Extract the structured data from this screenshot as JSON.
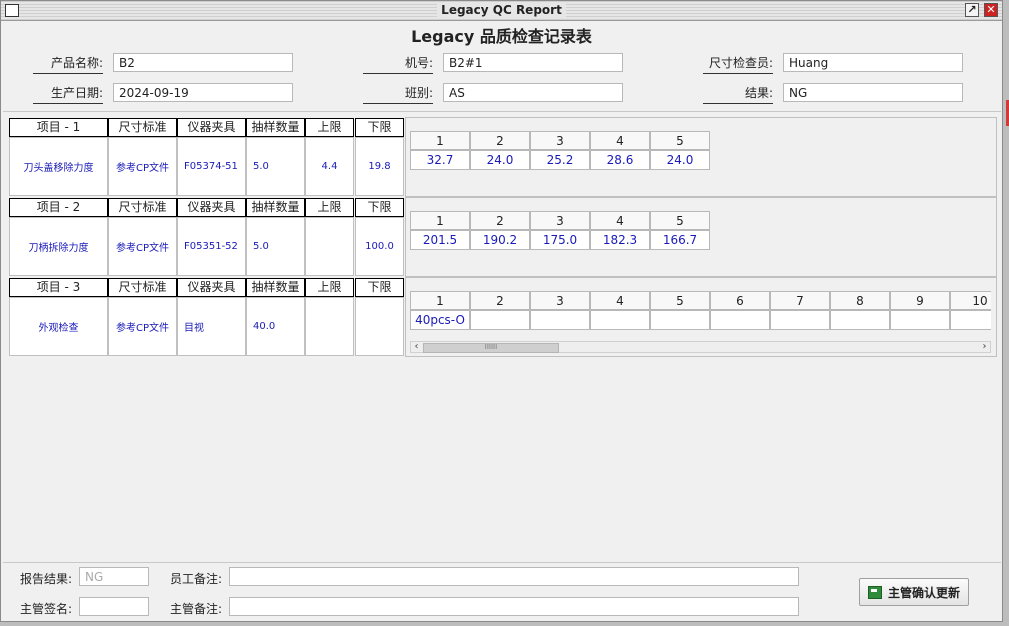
{
  "window": {
    "title": "Legacy QC Report"
  },
  "page_title": "Legacy 品质检查记录表",
  "header": {
    "product_name_label": "产品名称:",
    "product_name": "B2",
    "machine_no_label": "机号:",
    "machine_no": "B2#1",
    "inspector_label": "尺寸检查员:",
    "inspector": "Huang",
    "prod_date_label": "生产日期:",
    "prod_date": "2024-09-19",
    "shift_label": "班别:",
    "shift": "AS",
    "result_label": "结果:",
    "result": "NG"
  },
  "col_headers": [
    "尺寸标准",
    "仪器夹具",
    "抽样数量",
    "上限",
    "下限"
  ],
  "items": [
    {
      "title": "项目 - 1",
      "name": "刀头盖移除力度",
      "standard": "参考CP文件",
      "fixture": "F05374-51",
      "sample_qty": "5.0",
      "upper": "4.4",
      "lower": "19.8",
      "cols": [
        "1",
        "2",
        "3",
        "4",
        "5"
      ],
      "values": [
        "32.7",
        "24.0",
        "25.2",
        "28.6",
        "24.0"
      ]
    },
    {
      "title": "项目 - 2",
      "name": "刀柄拆除力度",
      "standard": "参考CP文件",
      "fixture": "F05351-52",
      "sample_qty": "5.0",
      "upper": "",
      "lower": "100.0",
      "cols": [
        "1",
        "2",
        "3",
        "4",
        "5"
      ],
      "values": [
        "201.5",
        "190.2",
        "175.0",
        "182.3",
        "166.7"
      ]
    },
    {
      "title": "项目 - 3",
      "name": "外观检查",
      "standard": "参考CP文件",
      "fixture": "目视",
      "sample_qty": "40.0",
      "upper": "",
      "lower": "",
      "cols": [
        "1",
        "2",
        "3",
        "4",
        "5",
        "6",
        "7",
        "8",
        "9",
        "10"
      ],
      "values": [
        "40pcs-O",
        "",
        "",
        "",
        "",
        "",
        "",
        "",
        "",
        ""
      ]
    }
  ],
  "scrollbar": {
    "left_arrow": "‹",
    "right_arrow": "›",
    "grip": "IIIIII"
  },
  "footer": {
    "report_result_label": "报告结果:",
    "report_result_placeholder": "NG",
    "employee_note_label": "员工备注:",
    "employee_note": "",
    "supervisor_sign_label": "主管签名:",
    "supervisor_sign": "",
    "supervisor_note_label": "主管备注:",
    "supervisor_note": "",
    "confirm_button": "主管确认更新"
  }
}
